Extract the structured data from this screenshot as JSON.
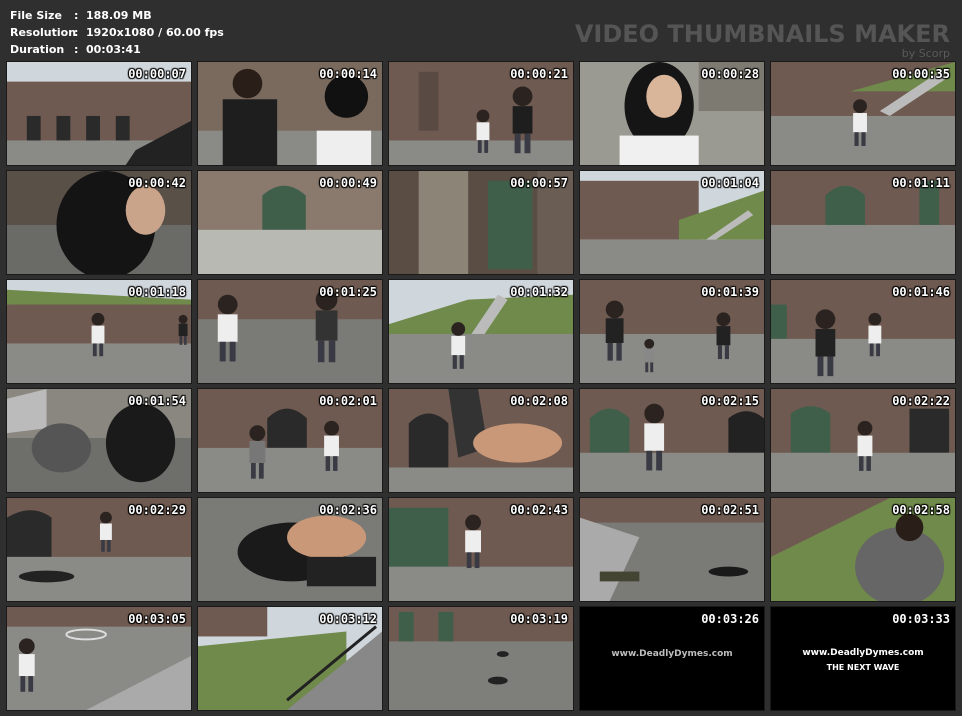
{
  "info": {
    "file_size_label": "File Size",
    "file_size_value": "188.09 MB",
    "resolution_label": "Resolution",
    "resolution_value": "1920x1080 / 60.00 fps",
    "duration_label": "Duration",
    "duration_value": "00:03:41",
    "separator": ":"
  },
  "brand": {
    "title": "VIDEO THUMBNAILS MAKER",
    "byline": "by Scorp"
  },
  "thumbnails": [
    {
      "time": "00:00:07",
      "scene": "courtyard-sky"
    },
    {
      "time": "00:00:14",
      "scene": "two-people"
    },
    {
      "time": "00:00:21",
      "scene": "couple-brick"
    },
    {
      "time": "00:00:28",
      "scene": "girl-closeup"
    },
    {
      "time": "00:00:35",
      "scene": "grass-stairs"
    },
    {
      "time": "00:00:42",
      "scene": "hair-closeup"
    },
    {
      "time": "00:00:49",
      "scene": "green-door"
    },
    {
      "time": "00:00:57",
      "scene": "wooden-door"
    },
    {
      "time": "00:01:04",
      "scene": "fort-corner"
    },
    {
      "time": "00:01:11",
      "scene": "arch-door"
    },
    {
      "time": "00:01:18",
      "scene": "wall-grass"
    },
    {
      "time": "00:01:25",
      "scene": "fight-ground"
    },
    {
      "time": "00:01:32",
      "scene": "stairs-fight"
    },
    {
      "time": "00:01:39",
      "scene": "three-fighters"
    },
    {
      "time": "00:01:46",
      "scene": "confront"
    },
    {
      "time": "00:01:54",
      "scene": "grapple"
    },
    {
      "time": "00:02:01",
      "scene": "push"
    },
    {
      "time": "00:02:08",
      "scene": "leg-closeup"
    },
    {
      "time": "00:02:15",
      "scene": "crouch"
    },
    {
      "time": "00:02:22",
      "scene": "kneel"
    },
    {
      "time": "00:02:29",
      "scene": "man-down"
    },
    {
      "time": "00:02:36",
      "scene": "hold"
    },
    {
      "time": "00:02:43",
      "scene": "kick"
    },
    {
      "time": "00:02:51",
      "scene": "steps-body"
    },
    {
      "time": "00:02:58",
      "scene": "hoodie-man"
    },
    {
      "time": "00:03:05",
      "scene": "girl-ground"
    },
    {
      "time": "00:03:12",
      "scene": "railing"
    },
    {
      "time": "00:03:19",
      "scene": "overhead"
    },
    {
      "time": "00:03:26",
      "scene": "black",
      "caption": "www.DeadlyDymes.com"
    },
    {
      "time": "00:03:33",
      "scene": "black",
      "caption": "www.DeadlyDymes.com",
      "caption2": "THE NEXT WAVE"
    }
  ],
  "colors": {
    "background": "#2f2f2f",
    "brick": "#6e5a50",
    "ground": "#8a8a86",
    "grass": "#6f8a4a",
    "door": "#3f5f4a",
    "sky": "#cfd6dc"
  }
}
